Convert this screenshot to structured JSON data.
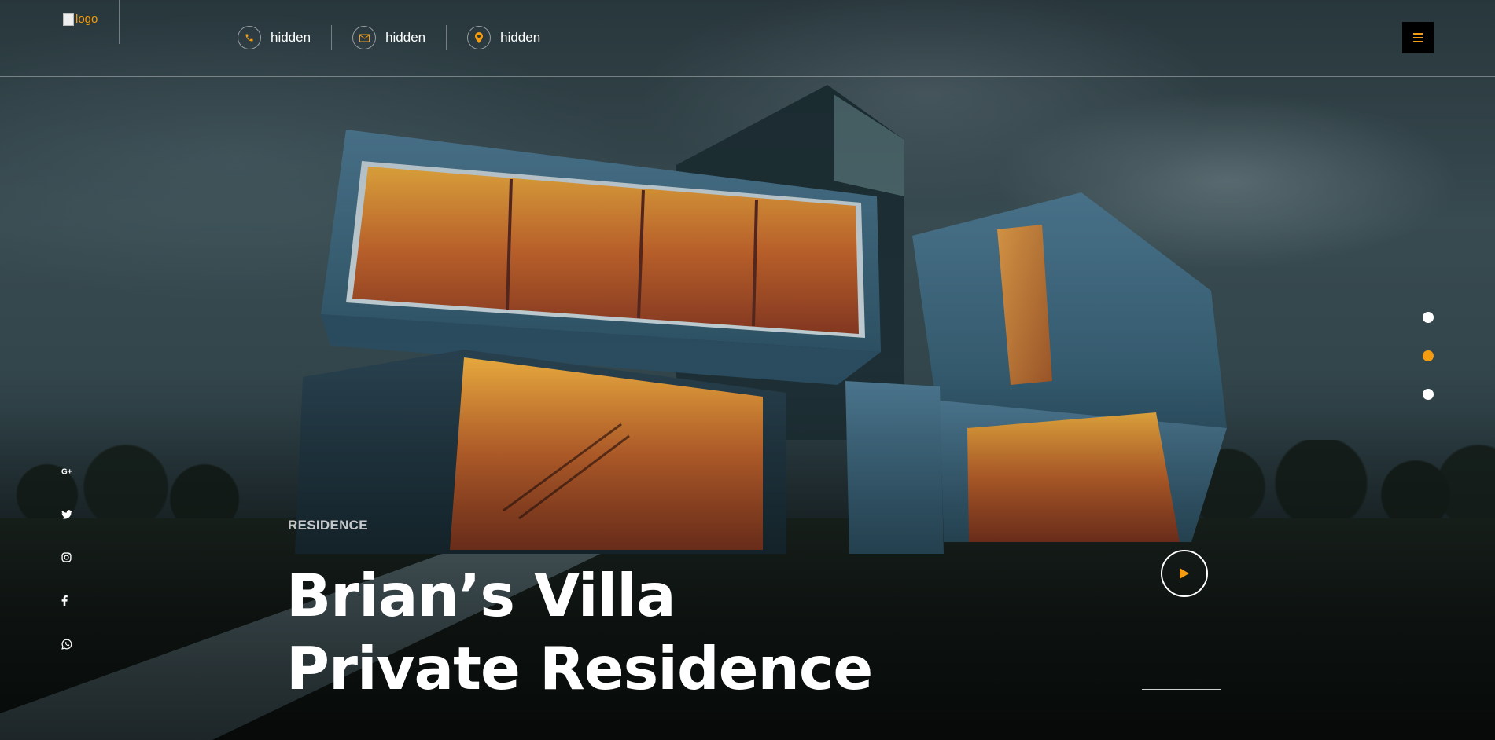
{
  "header": {
    "logo_alt": "logo",
    "contacts": [
      {
        "icon": "phone-icon",
        "text": "hidden"
      },
      {
        "icon": "envelope-icon",
        "text": "hidden"
      },
      {
        "icon": "map-pin-icon",
        "text": "hidden"
      }
    ],
    "menu_icon": "hamburger-icon"
  },
  "slider": {
    "dots": 3,
    "active_index": 1
  },
  "social": [
    {
      "icon": "google-plus-icon",
      "glyph": "G+"
    },
    {
      "icon": "twitter-icon",
      "glyph": "🐦"
    },
    {
      "icon": "instagram-icon",
      "glyph": "◎"
    },
    {
      "icon": "facebook-icon",
      "glyph": "f"
    },
    {
      "icon": "whatsapp-icon",
      "glyph": "✆"
    }
  ],
  "hero": {
    "subtitle": "RESIDENCE",
    "title_line1": "Brian’s Villa",
    "title_line2": "Private Residence",
    "play_icon": "play-icon"
  },
  "colors": {
    "accent": "#f39c12",
    "text": "#ffffff",
    "menu_bg": "#000000"
  }
}
